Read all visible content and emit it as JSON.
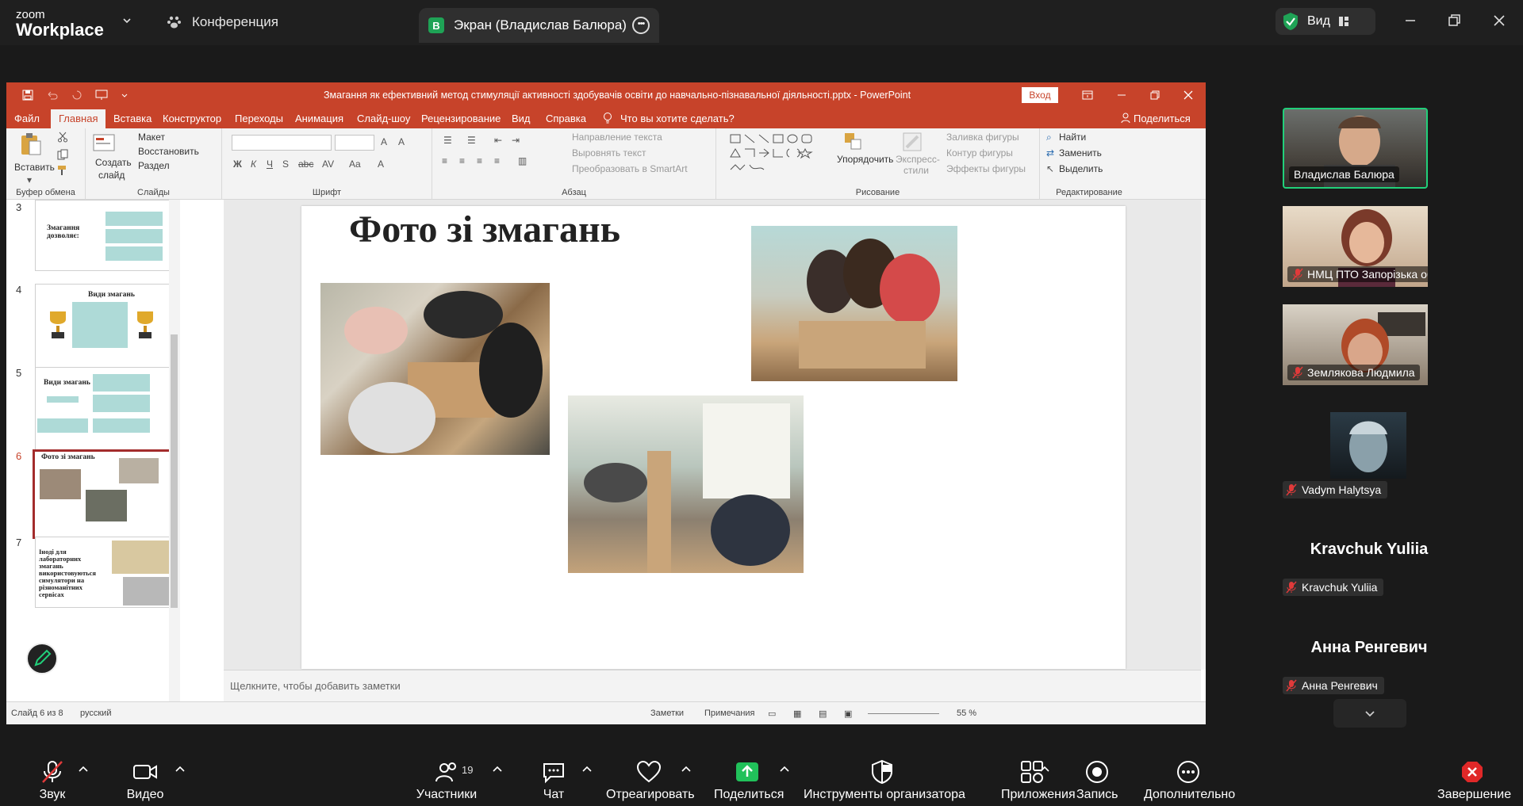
{
  "zoom": {
    "logo_small": "zoom",
    "logo_big": "Workplace",
    "conference_tab": "Конференция",
    "screen_tab_badge": "В",
    "screen_tab": "Экран (Владислав Балюра)",
    "view_label": "Вид",
    "accent_green": "#1fa356"
  },
  "ppt": {
    "title": "Змагання як ефективний метод стимуляції активності здобувачів освіти до навчально-пізнавальної діяльності.pptx - PowerPoint",
    "login": "Вход",
    "menu": [
      "Файл",
      "Главная",
      "Вставка",
      "Конструктор",
      "Переходы",
      "Анимация",
      "Слайд-шоу",
      "Рецензирование",
      "Вид",
      "Справка",
      "Что вы хотите сделать?"
    ],
    "share": "Поделиться",
    "ribbon": {
      "paste": "Вставить",
      "clipboard_group": "Буфер обмена",
      "new_slide_1": "Создать",
      "new_slide_2": "слайд",
      "layout": "Макет",
      "reset": "Восстановить",
      "section": "Раздел",
      "slides_group": "Слайды",
      "font_group": "Шрифт",
      "text_direction": "Направление текста",
      "align_text": "Выровнять текст",
      "smartart": "Преобразовать в SmartArt",
      "paragraph_group": "Абзац",
      "arrange_1": "Упорядочить",
      "quick_styles_1": "Экспресс-",
      "quick_styles_2": "стили",
      "shape_fill": "Заливка фигуры",
      "shape_outline": "Контур фигуры",
      "shape_effects": "Эффекты фигуры",
      "drawing_group": "Рисование",
      "find": "Найти",
      "replace": "Заменить",
      "select": "Выделить",
      "editing_group": "Редактирование"
    },
    "thumbnails": [
      {
        "num": "3",
        "title": "Змагання дозволяє:"
      },
      {
        "num": "4",
        "title": "Види змагань"
      },
      {
        "num": "5",
        "title": "Види змагань"
      },
      {
        "num": "6",
        "title": "Фото зі змагань"
      },
      {
        "num": "7",
        "title": "Іноді для лабораторних змагань використовуються симулятори на різноманітних сервісах"
      }
    ],
    "slide_title": "Фото зі змагань",
    "notes_placeholder": "Щелкните, чтобы добавить заметки",
    "status": {
      "slide_of": "Слайд 6 из 8",
      "language": "русский",
      "notes_btn": "Заметки",
      "comments_btn": "Примечания",
      "zoom": "55 %"
    }
  },
  "participants": [
    {
      "name": "Владислав Балюра",
      "muted": false
    },
    {
      "name": "НМЦ ПТО Запорізька об...",
      "muted": true
    },
    {
      "name": "Землякова Людмила",
      "muted": true
    },
    {
      "name": "Vadym Halytsya",
      "muted": true
    },
    {
      "name": "Kravchuk Yuliia",
      "muted": true
    },
    {
      "name": "Анна Ренгевич",
      "muted": true
    }
  ],
  "controls": {
    "audio": "Звук",
    "video": "Видео",
    "participants": "Участники",
    "participants_count": "19",
    "chat": "Чат",
    "react": "Отреагировать",
    "share": "Поделиться",
    "host_tools": "Инструменты организатора",
    "apps": "Приложения",
    "record": "Запись",
    "more": "Дополнительно",
    "end": "Завершение"
  }
}
